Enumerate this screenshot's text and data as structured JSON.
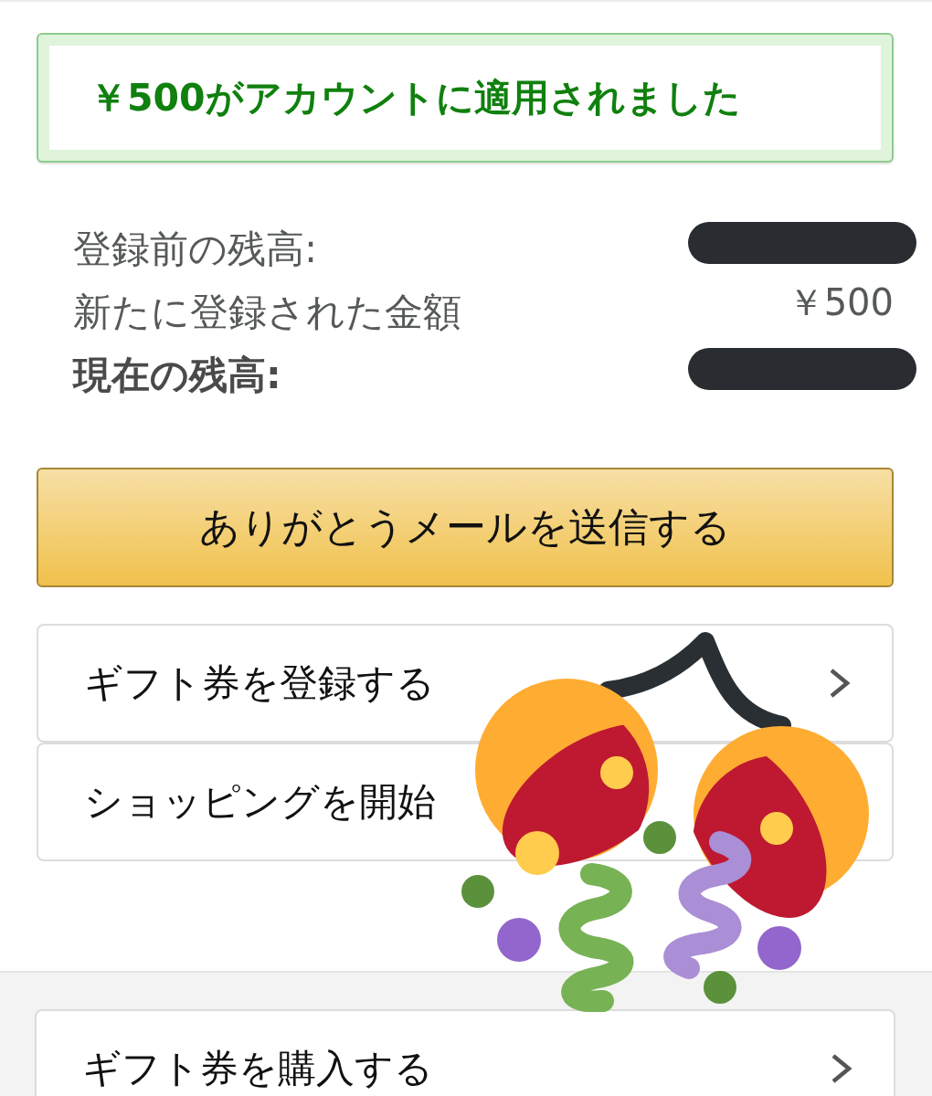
{
  "alert": {
    "message": "￥500がアカウントに適用されました"
  },
  "balances": [
    {
      "kind": "line",
      "label": "登録前の残高:",
      "redacted": true
    },
    {
      "kind": "line",
      "label": "新たに登録された金額",
      "value": "￥500",
      "redacted": false
    },
    {
      "kind": "total",
      "label": "現在の残高:",
      "redacted": true
    }
  ],
  "primary_button": {
    "label": "ありがとうメールを送信する"
  },
  "links": [
    {
      "label": "ギフト券を登録する",
      "chevron": true
    },
    {
      "label": "ショッピングを開始",
      "chevron": false
    }
  ],
  "footer_links": [
    {
      "label": "ギフト券を購入する",
      "chevron": true
    }
  ],
  "sticker": {
    "kind": "confetti_ball"
  }
}
